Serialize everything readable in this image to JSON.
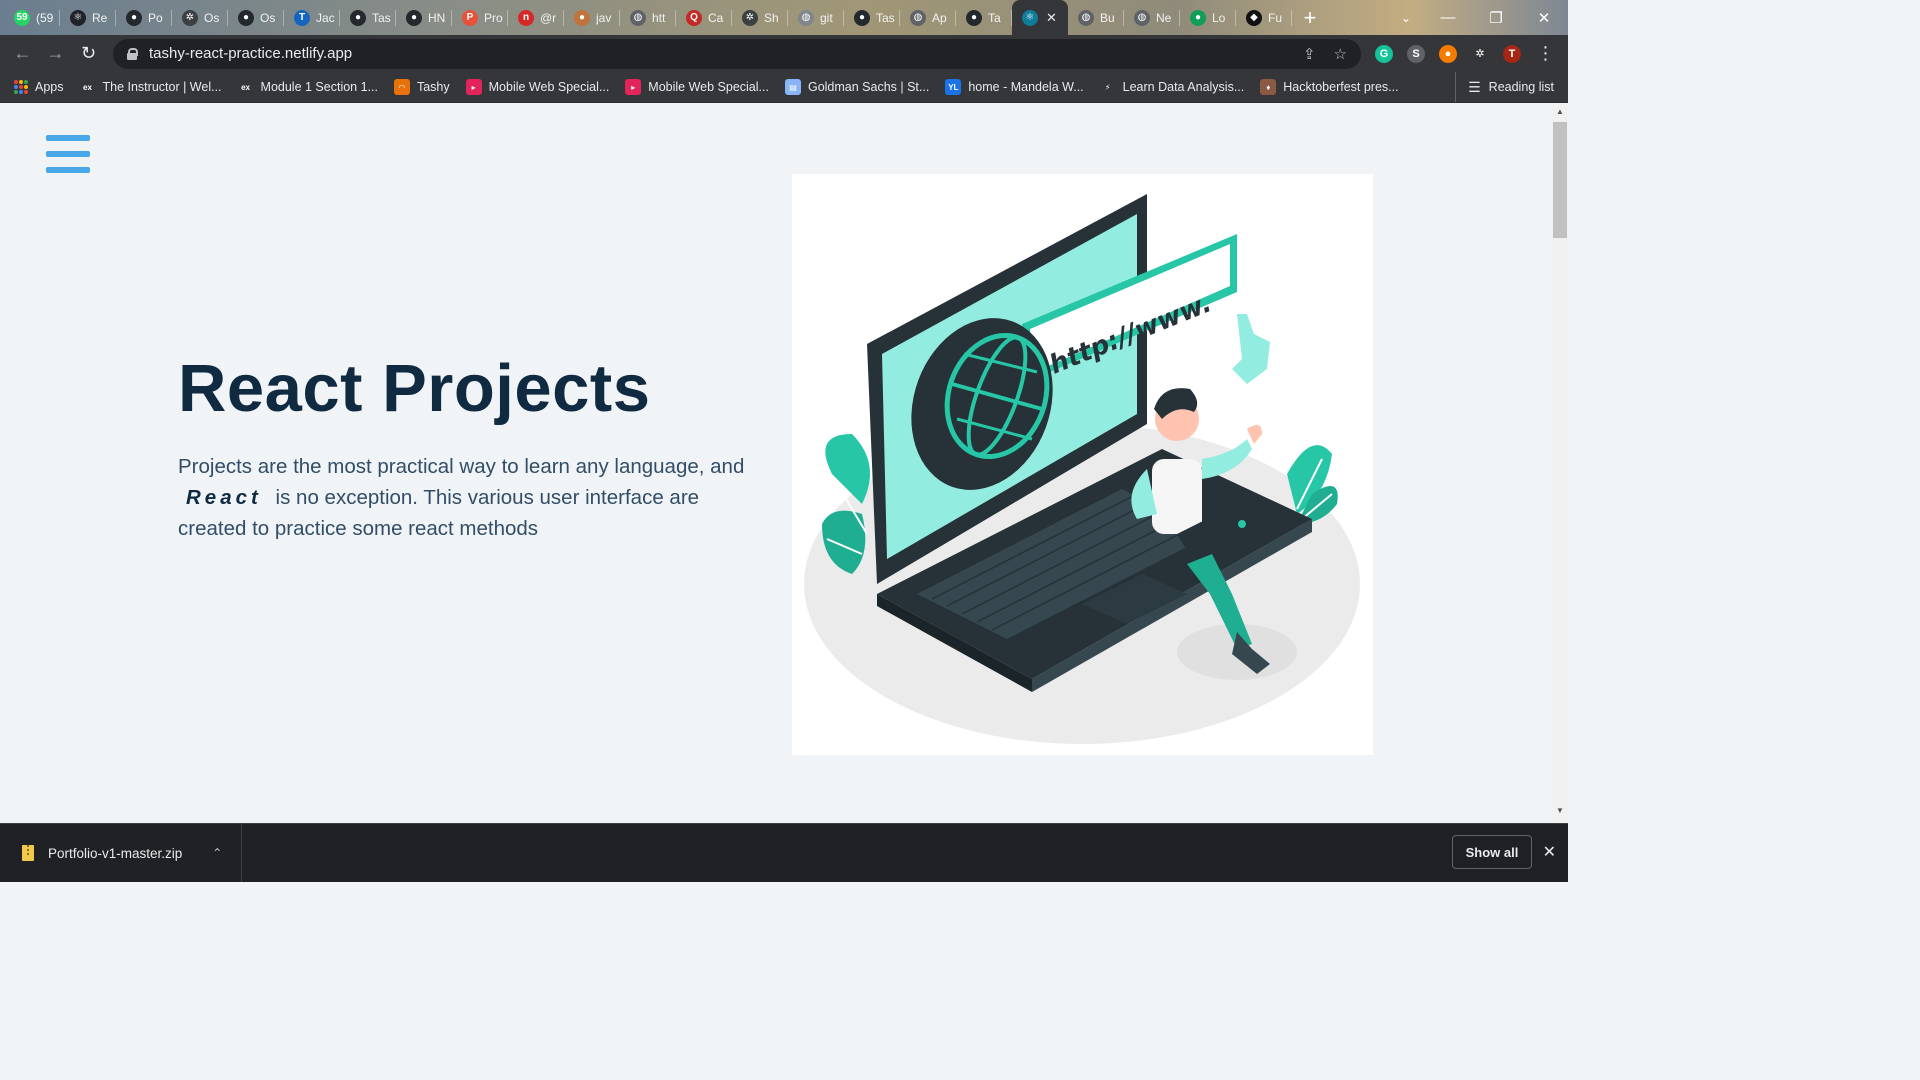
{
  "tabs": [
    {
      "title": "(59",
      "icon": "whatsapp-icon",
      "color": "#25d366",
      "glyph": "59"
    },
    {
      "title": "Re",
      "icon": "react-icon",
      "color": "#20232a",
      "glyph": "⚛"
    },
    {
      "title": "Po",
      "icon": "github-icon",
      "color": "#24292e",
      "glyph": "●"
    },
    {
      "title": "Os",
      "icon": "puzzle-icon",
      "color": "#3c4043",
      "glyph": "✲"
    },
    {
      "title": "Os",
      "icon": "github-icon",
      "color": "#24292e",
      "glyph": "●"
    },
    {
      "title": "Jac",
      "icon": "t-icon",
      "color": "#1565c0",
      "glyph": "T"
    },
    {
      "title": "Tas",
      "icon": "github-icon",
      "color": "#24292e",
      "glyph": "●"
    },
    {
      "title": "HN",
      "icon": "github-icon",
      "color": "#24292e",
      "glyph": "●"
    },
    {
      "title": "Pro",
      "icon": "p-icon",
      "color": "#e8513a",
      "glyph": "P"
    },
    {
      "title": "@r",
      "icon": "n-icon",
      "color": "#d62828",
      "glyph": "n"
    },
    {
      "title": "jav",
      "icon": "blog-icon",
      "color": "#c0733a",
      "glyph": "●"
    },
    {
      "title": "htt",
      "icon": "globe-icon",
      "color": "#5f6368",
      "glyph": "◍"
    },
    {
      "title": "Ca",
      "icon": "q-icon",
      "color": "#c62828",
      "glyph": "Q"
    },
    {
      "title": "Sh",
      "icon": "puzzle-icon",
      "color": "#3c4043",
      "glyph": "✲"
    },
    {
      "title": "git",
      "icon": "globe-icon",
      "color": "#80868b",
      "glyph": "◍"
    },
    {
      "title": "Tas",
      "icon": "github-icon",
      "color": "#24292e",
      "glyph": "●"
    },
    {
      "title": "Ap",
      "icon": "globe-icon",
      "color": "#5f6368",
      "glyph": "◍"
    },
    {
      "title": "Ta",
      "icon": "github-icon",
      "color": "#24292e",
      "glyph": "●"
    },
    {
      "title": "",
      "icon": "react-icon",
      "color": "#0f7c99",
      "glyph": "⚛",
      "active": true
    },
    {
      "title": "Bu",
      "icon": "globe-icon",
      "color": "#5f6368",
      "glyph": "◍"
    },
    {
      "title": "Ne",
      "icon": "globe-icon",
      "color": "#5f6368",
      "glyph": "◍"
    },
    {
      "title": "Lo",
      "icon": "dot-icon",
      "color": "#0f9d58",
      "glyph": "●"
    },
    {
      "title": "Fu",
      "icon": "tag-icon",
      "color": "#111111",
      "glyph": "◆"
    }
  ],
  "window": {
    "minimize": "—",
    "restore": "❐",
    "close": "✕",
    "tab_search": "⌄",
    "new_tab": "+"
  },
  "toolbar": {
    "back": "←",
    "forward": "→",
    "reload": "↻",
    "url": "tashy-react-practice.netlify.app",
    "share": "⇪",
    "star": "☆",
    "menu": "⋮"
  },
  "extensions": [
    {
      "icon": "grammarly-icon",
      "color": "#15c39a",
      "glyph": "G"
    },
    {
      "icon": "s-extension-icon",
      "color": "#5f6368",
      "glyph": "S"
    },
    {
      "icon": "honey-icon",
      "color": "#f57c00",
      "glyph": "●"
    },
    {
      "icon": "puzzle-icon",
      "color": "#35363a",
      "glyph": "✲"
    },
    {
      "icon": "profile-avatar",
      "color": "#a52714",
      "glyph": "T"
    }
  ],
  "bookmarks": {
    "apps_label": "Apps",
    "items": [
      {
        "label": "The Instructor | Wel...",
        "icon": "edx-icon",
        "color": "#35363a",
        "glyph": "ex"
      },
      {
        "label": "Module 1 Section 1...",
        "icon": "edx-icon",
        "color": "#35363a",
        "glyph": "ex"
      },
      {
        "label": "Tashy",
        "icon": "tashy-icon",
        "color": "#e8710a",
        "glyph": "◠"
      },
      {
        "label": "Mobile Web Special...",
        "icon": "udacity-icon",
        "color": "#e2245a",
        "glyph": "▸"
      },
      {
        "label": "Mobile Web Special...",
        "icon": "udacity-icon",
        "color": "#e2245a",
        "glyph": "▸"
      },
      {
        "label": "Goldman Sachs | St...",
        "icon": "page-icon",
        "color": "#8ab4f8",
        "glyph": "▤"
      },
      {
        "label": "home - Mandela W...",
        "icon": "yali-icon",
        "color": "#1a73e8",
        "glyph": "YL"
      },
      {
        "label": "Learn Data Analysis...",
        "icon": "datacamp-icon",
        "color": "#35363a",
        "glyph": "⚡"
      },
      {
        "label": "Hacktoberfest pres...",
        "icon": "hacktoberfest-icon",
        "color": "#8a5a44",
        "glyph": "♦"
      }
    ],
    "reading_list": "Reading list"
  },
  "page": {
    "title": "React Projects",
    "desc_before": "Projects are the most practical way to learn any language, and",
    "desc_emph": "React",
    "desc_after": "is no exception. This various user interface are created to practice some react methods",
    "accent": "#49a6e9"
  },
  "downloads": {
    "file": "Portfolio-v1-master.zip",
    "show_all": "Show all",
    "close": "✕",
    "expand": "⌃"
  }
}
